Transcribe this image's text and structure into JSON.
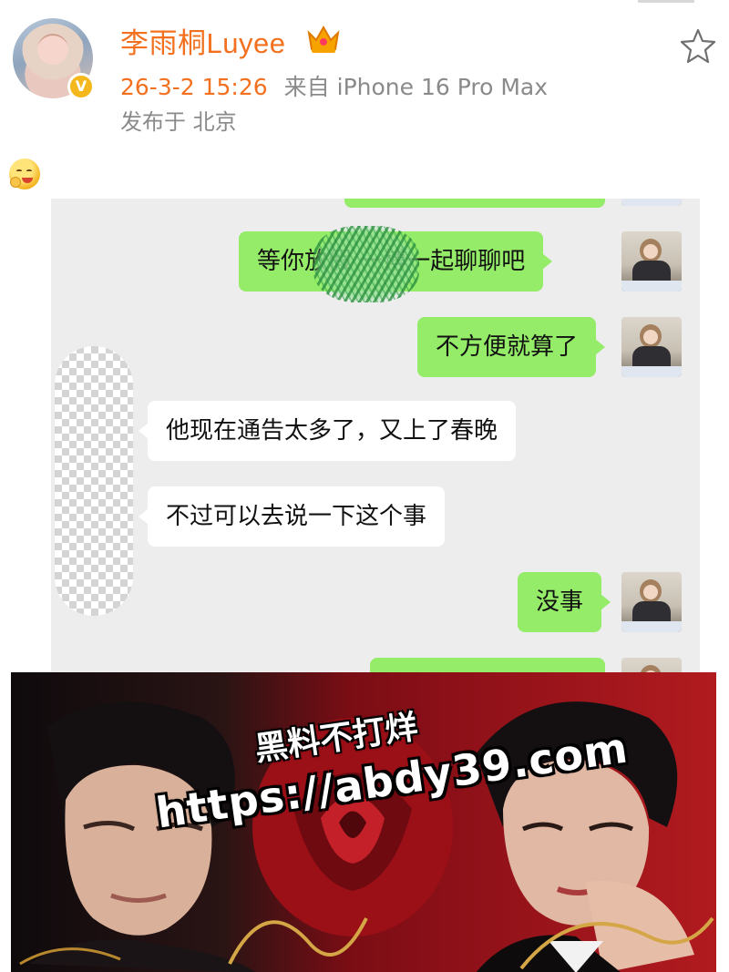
{
  "post": {
    "username": "李雨桐Luyee",
    "time": "26-3-2 15:26",
    "source": "来自 iPhone 16 Pro Max",
    "location": "发布于 北京",
    "verified_mark": "V"
  },
  "chat": {
    "messages": [
      {
        "side": "right",
        "text": "等你放假        一博一起聊聊吧"
      },
      {
        "side": "right",
        "text": "不方便就算了"
      },
      {
        "side": "left",
        "text": "他现在通告太多了，又上了春晚"
      },
      {
        "side": "left",
        "text": "不过可以去说一下这个事"
      },
      {
        "side": "right",
        "text": "没事"
      }
    ]
  },
  "ad": {
    "line1": "黑料不打烊",
    "line2": "https://abdy39.com"
  },
  "colors": {
    "username": "#f3701f",
    "meta": "#8a8a8a",
    "bubble_green": "#95ec69",
    "chat_bg": "#ededed"
  },
  "icons": [
    "crown-icon",
    "star-icon",
    "emoji-icon",
    "verified-badge-icon"
  ]
}
